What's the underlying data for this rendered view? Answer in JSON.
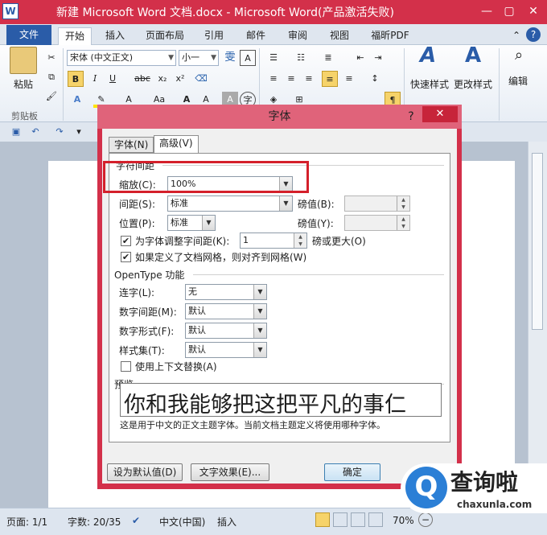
{
  "window": {
    "title": "新建 Microsoft Word 文档.docx - Microsoft Word(产品激活失败)",
    "app_icon_letter": "W",
    "help_glyph": "?"
  },
  "tabs": [
    "文件",
    "开始",
    "插入",
    "页面布局",
    "引用",
    "邮件",
    "审阅",
    "视图",
    "福昕PDF"
  ],
  "ribbon": {
    "paste_label": "粘贴",
    "clipboard_label": "剪贴板",
    "font_name": "宋体 (中文正文)",
    "font_size": "小一",
    "wen_glyph": "雯",
    "a_glyph": "A",
    "quick_styles": "快速样式",
    "change_styles": "更改样式",
    "editing": "编辑",
    "bold": "B",
    "italic": "I",
    "underline": "U",
    "strike": "abc",
    "sub": "x₂",
    "sup": "x²",
    "aa": "Aa",
    "zi_glyph": "字"
  },
  "dialog": {
    "title": "字体",
    "help": "?",
    "close": "✕",
    "tab_font": "字体(N)",
    "tab_advanced": "高级(V)",
    "section_spacing": "字符间距",
    "scale_label": "缩放(C):",
    "scale_value": "100%",
    "spacing_label": "间距(S):",
    "spacing_value": "标准",
    "spacing_pts_label": "磅值(B):",
    "position_label": "位置(P):",
    "position_value": "标准",
    "position_pts_label": "磅值(Y):",
    "kerning_label": "为字体调整字间距(K):",
    "kerning_value": "1",
    "kerning_suffix": "磅或更大(O)",
    "grid_label": "如果定义了文档网格，则对齐到网格(W)",
    "section_opentype": "OpenType 功能",
    "ligatures_label": "连字(L):",
    "ligatures_value": "无",
    "num_spacing_label": "数字间距(M):",
    "num_spacing_value": "默认",
    "num_forms_label": "数字形式(F):",
    "num_forms_value": "默认",
    "style_sets_label": "样式集(T):",
    "style_sets_value": "默认",
    "contextual_label": "使用上下文替换(A)",
    "section_preview": "预览",
    "preview_text": "你和我能够把这把平凡的事仁",
    "preview_note": "这是用于中文的正文主题字体。当前文档主题定义将使用哪种字体。",
    "btn_default": "设为默认值(D)",
    "btn_effects": "文字效果(E)...",
    "btn_ok": "确定"
  },
  "status": {
    "page": "页面: 1/1",
    "words": "字数: 20/35",
    "language": "中文(中国)",
    "insert": "插入",
    "zoom": "70%",
    "zoom_minus": "−"
  },
  "watermark": {
    "logo_letter": "Q",
    "name": "查询啦",
    "domain": "chaxunla.com"
  },
  "colors": {
    "title_bar": "#d3304a",
    "file_tab": "#2a5ca8",
    "highlight": "#d4202b"
  }
}
